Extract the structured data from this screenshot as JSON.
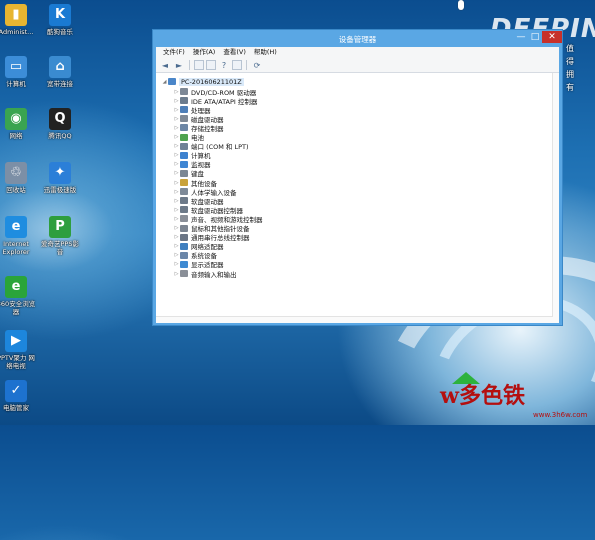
{
  "desktop": {
    "icons": [
      {
        "name": "admin-folder-icon",
        "label": "Administ...",
        "glyph": "▮",
        "color": "#e7b531"
      },
      {
        "name": "kugou-icon",
        "label": "酷狗音乐",
        "glyph": "K",
        "color": "#1a7ad2"
      },
      {
        "name": "computer-icon",
        "label": "计算机",
        "glyph": "▭",
        "color": "#3c8dd8"
      },
      {
        "name": "broadband-icon",
        "label": "宽带连接",
        "glyph": "⌂",
        "color": "#3a8bd0"
      },
      {
        "name": "network-icon",
        "label": "网络",
        "glyph": "◉",
        "color": "#3aa450"
      },
      {
        "name": "qq-icon",
        "label": "腾讯QQ",
        "glyph": "Q",
        "color": "#222222"
      },
      {
        "name": "recycle-bin-icon",
        "label": "回收站",
        "glyph": "♲",
        "color": "#7c8fa6"
      },
      {
        "name": "xunlei-icon",
        "label": "迅雷极速版",
        "glyph": "✦",
        "color": "#2b7fd8"
      },
      {
        "name": "ie-icon",
        "label": "Internet Explorer",
        "glyph": "e",
        "color": "#1f8de0"
      },
      {
        "name": "pps-icon",
        "label": "爱奇艺PPS影音",
        "glyph": "P",
        "color": "#2e9e3e"
      },
      {
        "name": "360-browser-icon",
        "label": "360安全浏览器",
        "glyph": "e",
        "color": "#2aa43a"
      },
      {
        "name": "pptv-icon",
        "label": "PPTV聚力 网络电视",
        "glyph": "▶",
        "color": "#1d86dc"
      },
      {
        "name": "pc-manager-icon",
        "label": "电脑管家",
        "glyph": "✓",
        "color": "#1d72cf"
      }
    ],
    "brand_text": "DEEPIN",
    "side_text": "值得拥有",
    "watermark_text": "w多色铁",
    "watermark_url": "www.3h6w.com"
  },
  "window": {
    "title": "设备管理器",
    "controls": {
      "minimize": "—",
      "maximize": "□",
      "close": "✕"
    },
    "menu": [
      "文件(F)",
      "操作(A)",
      "查看(V)",
      "帮助(H)"
    ],
    "toolbar": [
      {
        "name": "back-arrow-icon",
        "glyph": "◄"
      },
      {
        "name": "forward-arrow-icon",
        "glyph": "►"
      },
      {
        "name": "properties-icon",
        "glyph": ""
      },
      {
        "name": "show-hide-icon",
        "glyph": ""
      },
      {
        "name": "help-icon",
        "glyph": "?"
      },
      {
        "name": "view-icon",
        "glyph": ""
      },
      {
        "name": "scan-hardware-icon",
        "glyph": "⟳"
      }
    ],
    "tree": {
      "root": "PC-20160621101Z",
      "items": [
        {
          "label": "DVD/CD-ROM 驱动器",
          "icon": "dvd-drive-icon",
          "color": "#7d8896"
        },
        {
          "label": "IDE ATA/ATAPI 控制器",
          "icon": "ide-controller-icon",
          "color": "#6c7c8e"
        },
        {
          "label": "处理器",
          "icon": "processor-icon",
          "color": "#4e7fb8"
        },
        {
          "label": "磁盘驱动器",
          "icon": "disk-drive-icon",
          "color": "#808a96"
        },
        {
          "label": "存储控制器",
          "icon": "storage-controller-icon",
          "color": "#6d87a6"
        },
        {
          "label": "电池",
          "icon": "battery-icon",
          "color": "#4fa34f"
        },
        {
          "label": "端口 (COM 和 LPT)",
          "icon": "port-icon",
          "color": "#6f8196"
        },
        {
          "label": "计算机",
          "icon": "computer-node-icon",
          "color": "#3d82cf"
        },
        {
          "label": "监视器",
          "icon": "monitor-icon",
          "color": "#3f86d3"
        },
        {
          "label": "键盘",
          "icon": "keyboard-icon",
          "color": "#7b8794"
        },
        {
          "label": "其他设备",
          "icon": "other-devices-icon",
          "color": "#c9a23a"
        },
        {
          "label": "人体学输入设备",
          "icon": "hid-icon",
          "color": "#7e8a98"
        },
        {
          "label": "软盘驱动器",
          "icon": "floppy-drive-icon",
          "color": "#6d7a89"
        },
        {
          "label": "软盘驱动器控制器",
          "icon": "floppy-controller-icon",
          "color": "#6d7a89"
        },
        {
          "label": "声音、视频和游戏控制器",
          "icon": "sound-icon",
          "color": "#8a8f98"
        },
        {
          "label": "鼠标和其他指针设备",
          "icon": "mouse-icon",
          "color": "#7c8591"
        },
        {
          "label": "通用串行总线控制器",
          "icon": "usb-icon",
          "color": "#6b7686"
        },
        {
          "label": "网络适配器",
          "icon": "network-adapter-icon",
          "color": "#3f7fbf"
        },
        {
          "label": "系统设备",
          "icon": "system-devices-icon",
          "color": "#6b86a8"
        },
        {
          "label": "显示适配器",
          "icon": "display-adapter-icon",
          "color": "#3e8ad2"
        },
        {
          "label": "音频输入和输出",
          "icon": "audio-io-icon",
          "color": "#8a8f98"
        }
      ]
    }
  }
}
